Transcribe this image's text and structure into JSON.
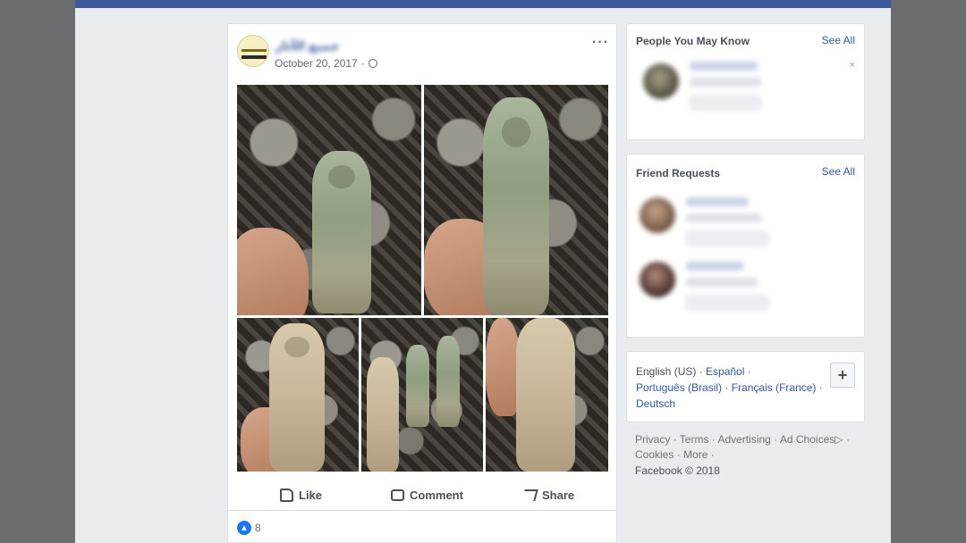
{
  "post": {
    "author": "جميع الآثار",
    "date": "October 20, 2017",
    "separator": "·",
    "more": "···",
    "actions": {
      "like": "Like",
      "comment": "Comment",
      "share": "Share"
    },
    "reaction_count": "8"
  },
  "sidebar": {
    "people": {
      "title": "People You May Know",
      "see_all": "See All",
      "close": "×"
    },
    "requests": {
      "title": "Friend Requests",
      "see_all": "See All"
    },
    "languages": {
      "line1_a": "English (US)",
      "line1_b": "Español",
      "line2_a": "Português (Brasil)",
      "line2_b": "Français (France)",
      "line3": "Deutsch",
      "plus": "+"
    },
    "footer": {
      "privacy": "Privacy",
      "terms": "Terms",
      "advertising": "Advertising",
      "ad_choices": "Ad Choices",
      "cookies": "Cookies",
      "more": "More",
      "copyright": "Facebook © 2018"
    }
  },
  "colors": {
    "brand": "#3b5998",
    "link": "#365899",
    "page_bg": "#e9ebee"
  }
}
